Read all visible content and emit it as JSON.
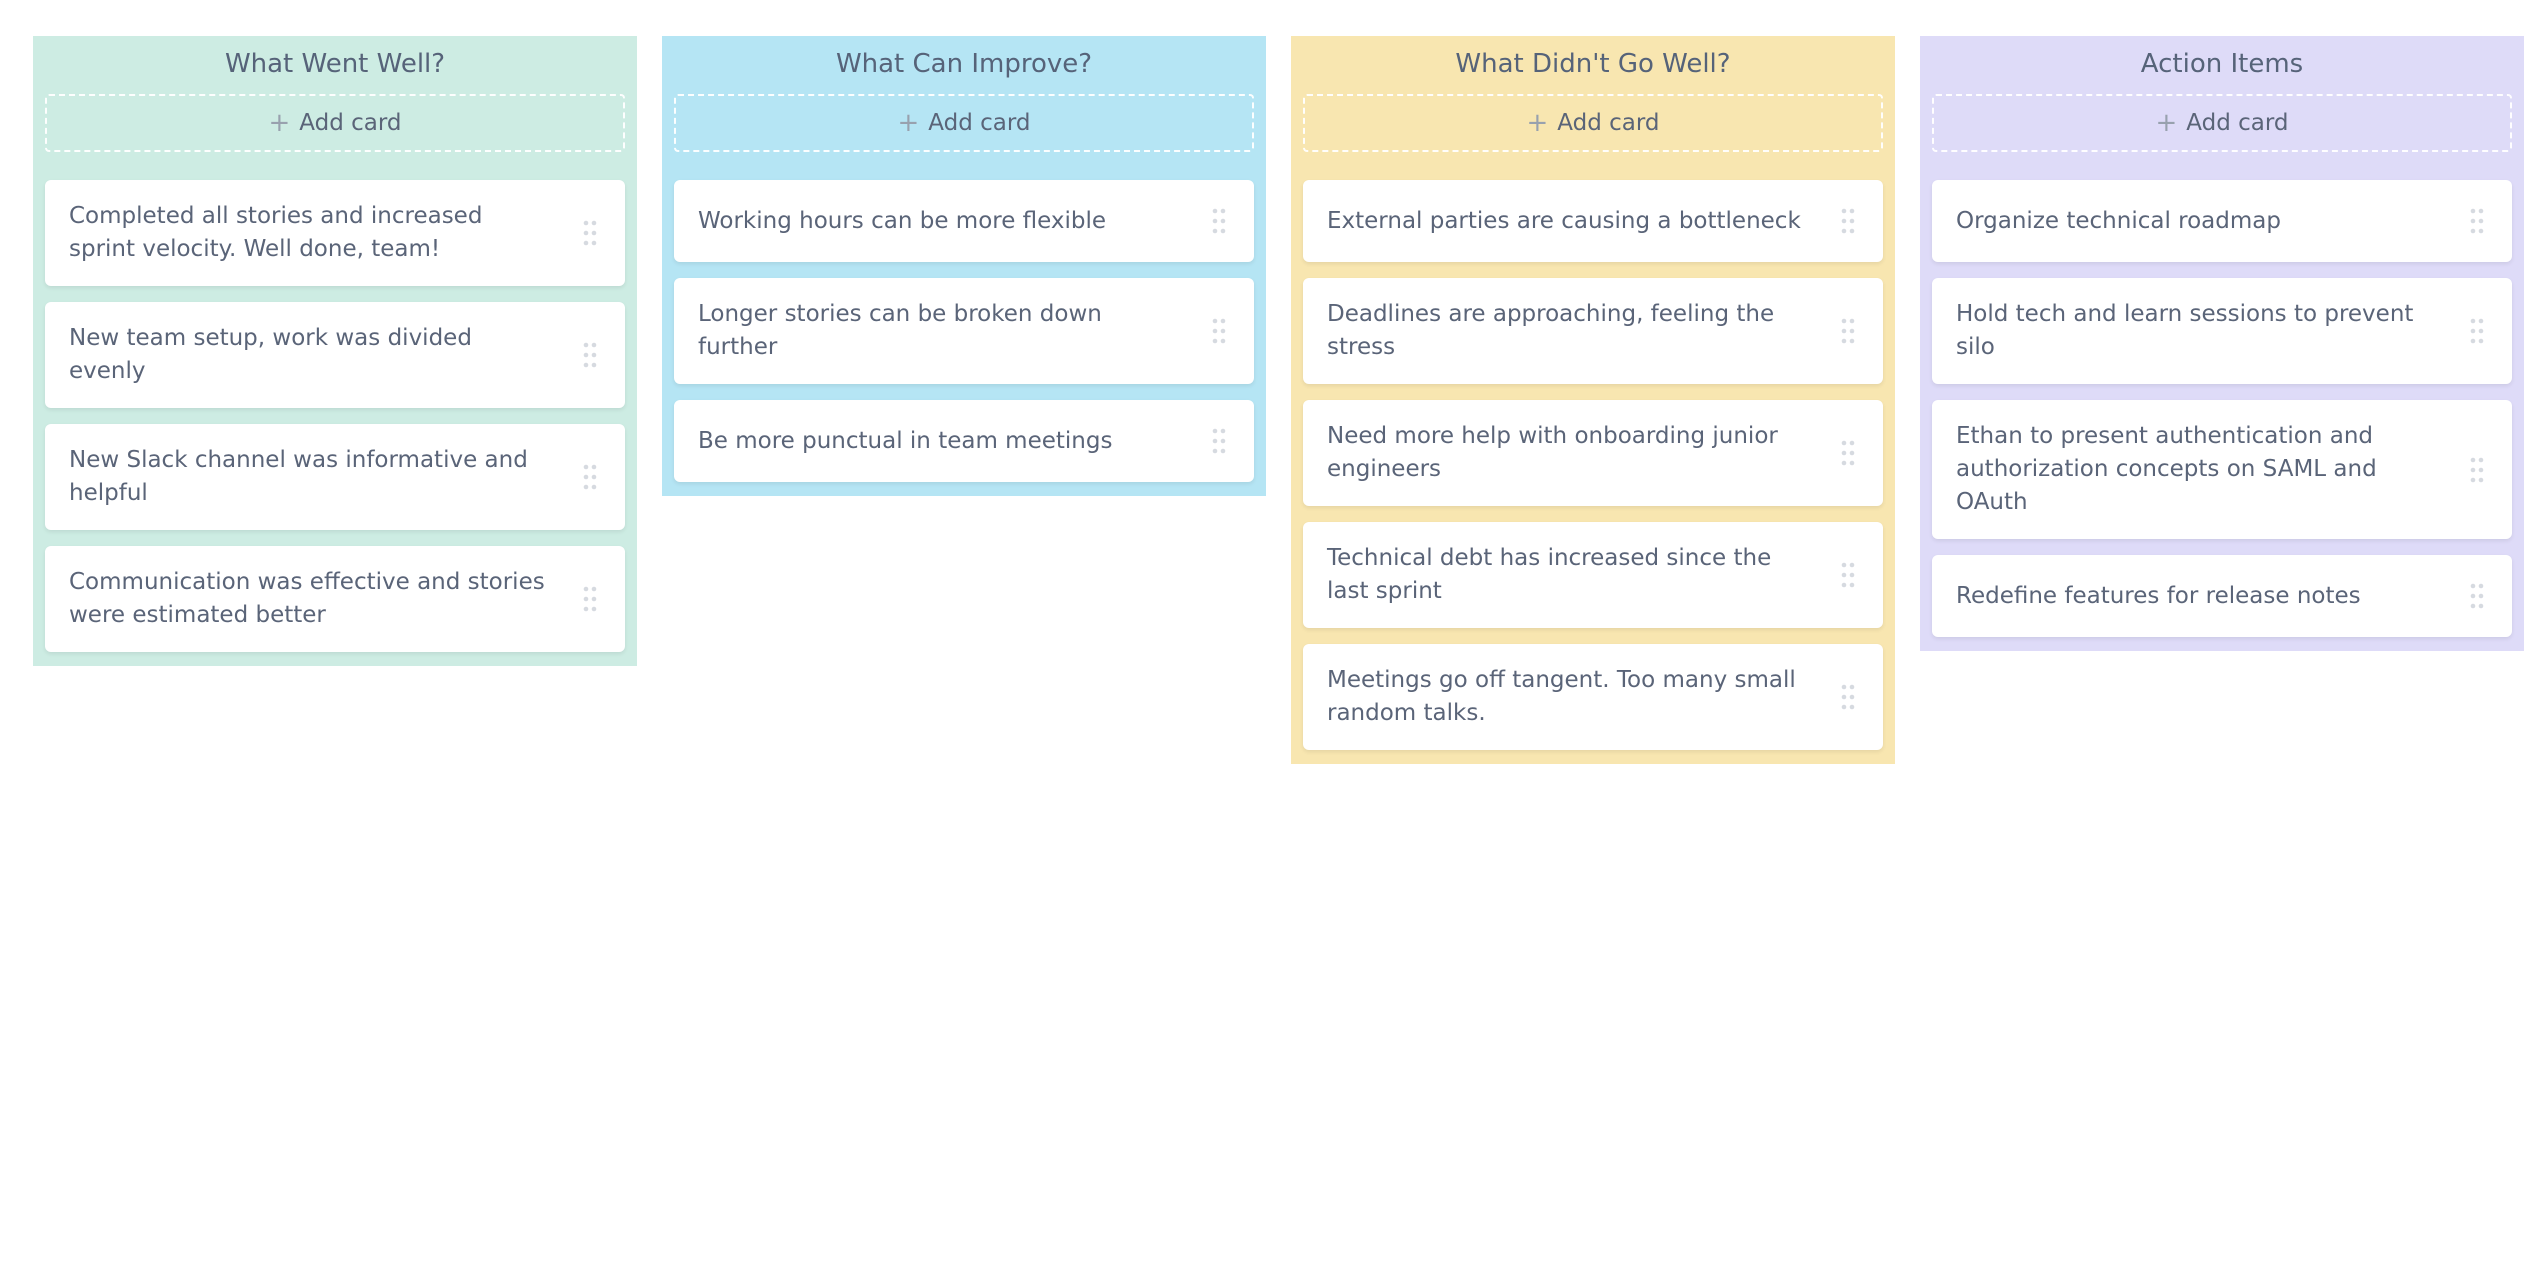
{
  "board": {
    "add_card_label": "Add card",
    "columns": [
      {
        "title": "What Went Well?",
        "color": "#cdece3",
        "cards": [
          "Completed all stories and increased sprint velocity. Well done, team!",
          "New team setup, work was divided evenly",
          "New Slack channel was informative and helpful",
          "Communication was effective and stories were estimated better"
        ]
      },
      {
        "title": "What Can Improve?",
        "color": "#b5e5f4",
        "cards": [
          "Working hours can be more flexible",
          "Longer stories can be broken down further",
          "Be more punctual in team meetings"
        ]
      },
      {
        "title": "What Didn't Go Well?",
        "color": "#f8e6b0",
        "cards": [
          "External parties are causing a bottleneck",
          "Deadlines are approaching, feeling the stress",
          "Need more help with onboarding junior engineers",
          "Technical debt has increased since the last sprint",
          "Meetings go off tangent. Too many small random talks."
        ]
      },
      {
        "title": "Action Items",
        "color": "#dedbf8",
        "cards": [
          "Organize technical roadmap",
          "Hold tech and learn sessions to prevent silo",
          "Ethan to present authentication and authorization concepts on SAML and OAuth",
          "Redefine features for release notes"
        ]
      }
    ]
  },
  "icons": {
    "add": "plus-icon",
    "drag": "drag-handle-icon"
  },
  "colors": {
    "text": "#5a6478",
    "title_text": "#566379",
    "drag_dots": "#d6dae0"
  }
}
